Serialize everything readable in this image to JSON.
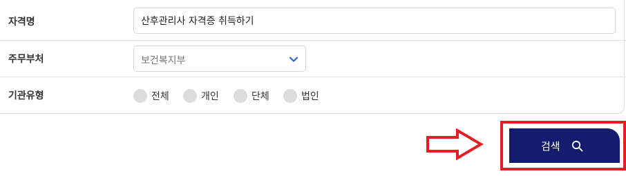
{
  "form": {
    "qualification_name": {
      "label": "자격명",
      "value": "산후관리사 자격증 취득하기"
    },
    "department": {
      "label": "주무부처",
      "selected": "보건복지부"
    },
    "org_type": {
      "label": "기관유형",
      "options": [
        "전체",
        "개인",
        "단체",
        "법인"
      ]
    }
  },
  "actions": {
    "search_label": "검색"
  },
  "colors": {
    "button_bg": "#151c70",
    "highlight": "#e31e24",
    "radio": "#dcdcdc",
    "chevron": "#1f5fbf"
  },
  "icons": {
    "select": "chevron-down-icon",
    "search": "search-icon",
    "annotation": "right-arrow-icon"
  }
}
